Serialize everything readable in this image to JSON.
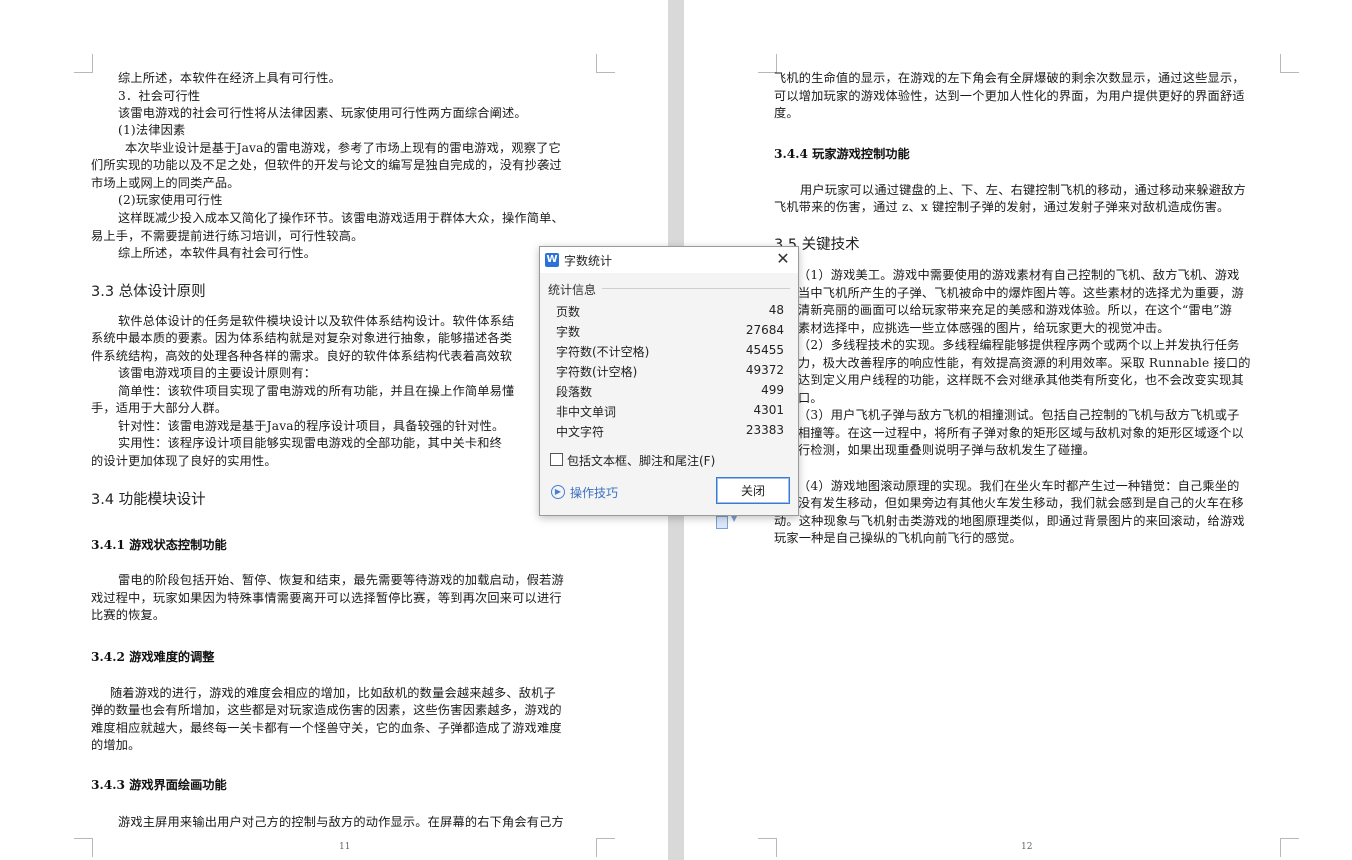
{
  "left_page": {
    "lines": [
      "综上所述，本软件在经济上具有可行性。",
      "3．社会可行性",
      "该雷电游戏的社会可行性将从法律因素、玩家使用可行性两方面综合阐述。",
      "(1)法律因素",
      "本次毕业设计是基于Java的雷电游戏，参考了市场上现有的雷电游戏，观察了它",
      "们所实现的功能以及不足之处，但软件的开发与论文的编写是独自完成的，没有抄袭过",
      "市场上或网上的同类产品。",
      "(2)玩家使用可行性",
      "这样既减少投入成本又简化了操作环节。该雷电游戏适用于群体大众，操作简单、",
      "易上手，不需要提前进行练习培训，可行性较高。",
      "综上所述，本软件具有社会可行性。"
    ],
    "heading_33": "3.3 总体设计原则",
    "lines_33": [
      "软件总体设计的任务是软件模块设计以及软件体系结构设计。软件体系结",
      "系统中最本质的要素。因为体系结构就是对复杂对象进行抽象，能够描述各类",
      "件系统结构，高效的处理各种各样的需求。良好的软件体系结构代表着高效软",
      "该雷电游戏项目的主要设计原则有：",
      "简单性：该软件项目实现了雷电游戏的所有功能，并且在操上作简单易懂",
      "手，适用于大部分人群。",
      "针对性：该雷电游戏是基于Java的程序设计项目，具备较强的针对性。",
      "实用性：该程序设计项目能够实现雷电游戏的全部功能，其中关卡和终",
      "的设计更加体现了良好的实用性。"
    ],
    "heading_34": "3.4 功能模块设计",
    "heading_341": "3.4.1 游戏状态控制功能",
    "lines_341": [
      "雷电的阶段包括开始、暂停、恢复和结束，最先需要等待游戏的加载启动，假若游",
      "戏过程中，玩家如果因为特殊事情需要离开可以选择暂停比赛，等到再次回来可以进行",
      "比赛的恢复。"
    ],
    "heading_342": "3.4.2 游戏难度的调整",
    "lines_342": [
      "随着游戏的进行，游戏的难度会相应的增加，比如敌机的数量会越来越多、敌机子",
      "弹的数量也会有所增加，这些都是对玩家造成伤害的因素，这些伤害因素越多，游戏的",
      "难度相应就越大，最终每一关卡都有一个怪兽守关，它的血条、子弹都造成了游戏难度",
      "的增加。"
    ],
    "heading_343": "3.4.3 游戏界面绘画功能",
    "lines_343": [
      "游戏主屏用来输出用户对己方的控制与敌方的动作显示。在屏幕的右下角会有己方"
    ],
    "page_number": "11"
  },
  "right_page": {
    "lines_top": [
      "飞机的生命值的显示，在游戏的左下角会有全屏爆破的剩余次数显示，通过这些显示，",
      "可以增加玩家的游戏体验性，达到一个更加人性化的界面，为用户提供更好的界面舒适",
      "度。"
    ],
    "heading_344": "3.4.4 玩家游戏控制功能",
    "lines_344": [
      "用户玩家可以通过键盘的上、下、左、右键控制飞机的移动，通过移动来躲避敌方",
      "飞机带来的伤害，通过 z、x 键控制子弹的发射，通过发射子弹来对敌机造成伤害。"
    ],
    "heading_35": "3.5 关键技术",
    "lines_35": [
      "（1）游戏美工。游戏中需要使用的游戏素材有自己控制的飞机、敌方飞机、游戏",
      "当中飞机所产生的子弹、飞机被命中的爆炸图片等。这些素材的选择尤为重要，游",
      "清新亮丽的画面可以给玩家带来充足的美感和游戏体验。所以，在这个“雷电”游",
      "素材选择中，应挑选一些立体感强的图片，给玩家更大的视觉冲击。",
      "（2）多线程技术的实现。多线程编程能够提供程序两个或两个以上并发执行任务",
      "力，极大改善程序的响应性能，有效提高资源的利用效率。采取 Runnable 接口的",
      "达到定义用户线程的功能，这样既不会对继承其他类有所变化，也不会改变实现其",
      "口。",
      "（3）用户飞机子弹与敌方飞机的相撞测试。包括自己控制的飞机与敌方飞机或子",
      "相撞等。在这一过程中，将所有子弹对象的矩形区域与敌机对象的矩形区域逐个以",
      "行检测，如果出现重叠则说明子弹与敌机发生了碰撞。"
    ],
    "lines_35b": [
      "（4）游戏地图滚动原理的实现。我们在坐火车时都产生过一种错觉：自己乘坐的",
      "没有发生移动，但如果旁边有其他火车发生移动，我们就会感到是自己的火车在移",
      "动。这种现象与飞机射击类游戏的地图原理类似，即通过背景图片的来回滚动，给游戏",
      "玩家一种是自己操纵的飞机向前飞行的感觉。"
    ],
    "page_number": "12"
  },
  "dialog": {
    "logo": "W",
    "title": "字数统计",
    "close_glyph": "✕",
    "section": "统计信息",
    "stats": [
      {
        "label": "页数",
        "value": "48"
      },
      {
        "label": "字数",
        "value": "27684"
      },
      {
        "label": "字符数(不计空格)",
        "value": "45455"
      },
      {
        "label": "字符数(计空格)",
        "value": "49372"
      },
      {
        "label": "段落数",
        "value": "499"
      },
      {
        "label": "非中文单词",
        "value": "4301"
      },
      {
        "label": "中文字符",
        "value": "23383"
      }
    ],
    "checkbox_label": "包括文本框、脚注和尾注(F)",
    "checkbox_checked": false,
    "tips_label": "操作技巧",
    "close_button": "关闭"
  }
}
